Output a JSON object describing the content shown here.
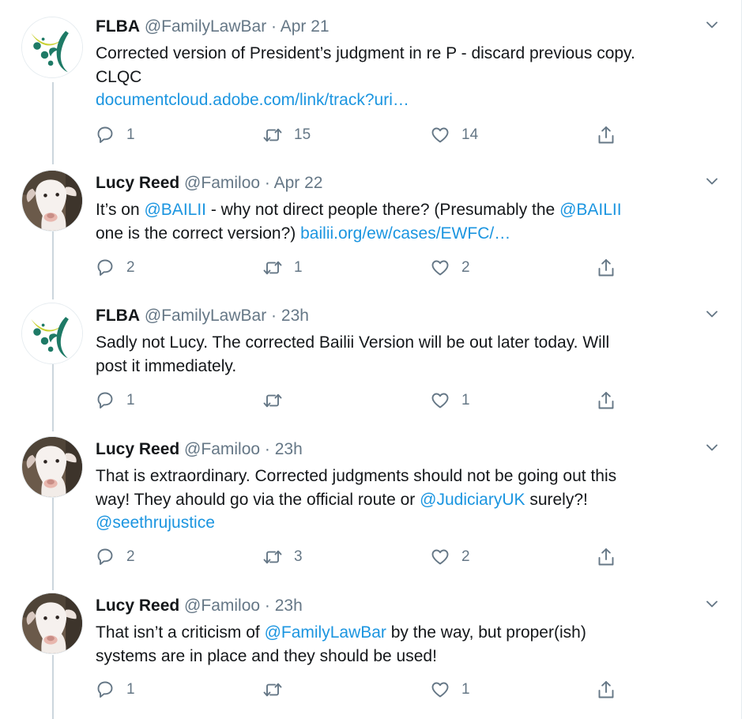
{
  "tweets": [
    {
      "author": "FLBA",
      "handle": "@FamilyLawBar",
      "sep": "·",
      "time": "Apr 21",
      "avatar_icon": "flba-logo-icon",
      "text1": "Corrected version of President’s judgment in re P - discard previous copy.",
      "text2": "CLQC",
      "link": "documentcloud.adobe.com/link/track?uri…",
      "replies": "1",
      "retweets": "15",
      "likes": "14"
    },
    {
      "author": "Lucy Reed",
      "handle": "@Familoo",
      "sep": "·",
      "time": "Apr 22",
      "avatar_icon": "dog-avatar-icon",
      "p1": "It’s on ",
      "m1": "@BAILII",
      "p2": " - why not direct people there? (Presumably the ",
      "m2": "@BAILII",
      "p3": " one is the correct version?) ",
      "link": "bailii.org/ew/cases/EWFC/…",
      "replies": "2",
      "retweets": "1",
      "likes": "2"
    },
    {
      "author": "FLBA",
      "handle": "@FamilyLawBar",
      "sep": "·",
      "time": "23h",
      "avatar_icon": "flba-logo-icon",
      "text1": "Sadly not Lucy. The corrected Bailii Version will be out later today. Will",
      "text2": "post it immediately.",
      "replies": "1",
      "retweets": "",
      "likes": "1"
    },
    {
      "author": "Lucy Reed",
      "handle": "@Familoo",
      "sep": "·",
      "time": "23h",
      "avatar_icon": "dog-avatar-icon",
      "line1": "That is extraordinary. Corrected judgments should not be going out this",
      "line2a": "way! They ahould go via the official route or ",
      "m1": "@JudiciaryUK",
      "line2b": " surely?!",
      "m2": "@seethrujustice",
      "replies": "2",
      "retweets": "3",
      "likes": "2"
    },
    {
      "author": "Lucy Reed",
      "handle": "@Familoo",
      "sep": "·",
      "time": "23h",
      "avatar_icon": "dog-avatar-icon",
      "p1": "That isn’t a criticism of ",
      "m1": "@FamilyLawBar",
      "p2": " by the way, but proper(ish)",
      "line2": "systems are in place and they should be used!",
      "replies": "1",
      "retweets": "",
      "likes": "1"
    }
  ],
  "colors": {
    "link": "#1b95e0",
    "secondary_text": "#657786",
    "thread_line": "#ccd6dd",
    "logo_green": "#1e7a66",
    "logo_yellow": "#c9d130"
  },
  "icons": [
    "reply-icon",
    "retweet-icon",
    "like-icon",
    "share-icon",
    "chevron-down-icon"
  ]
}
